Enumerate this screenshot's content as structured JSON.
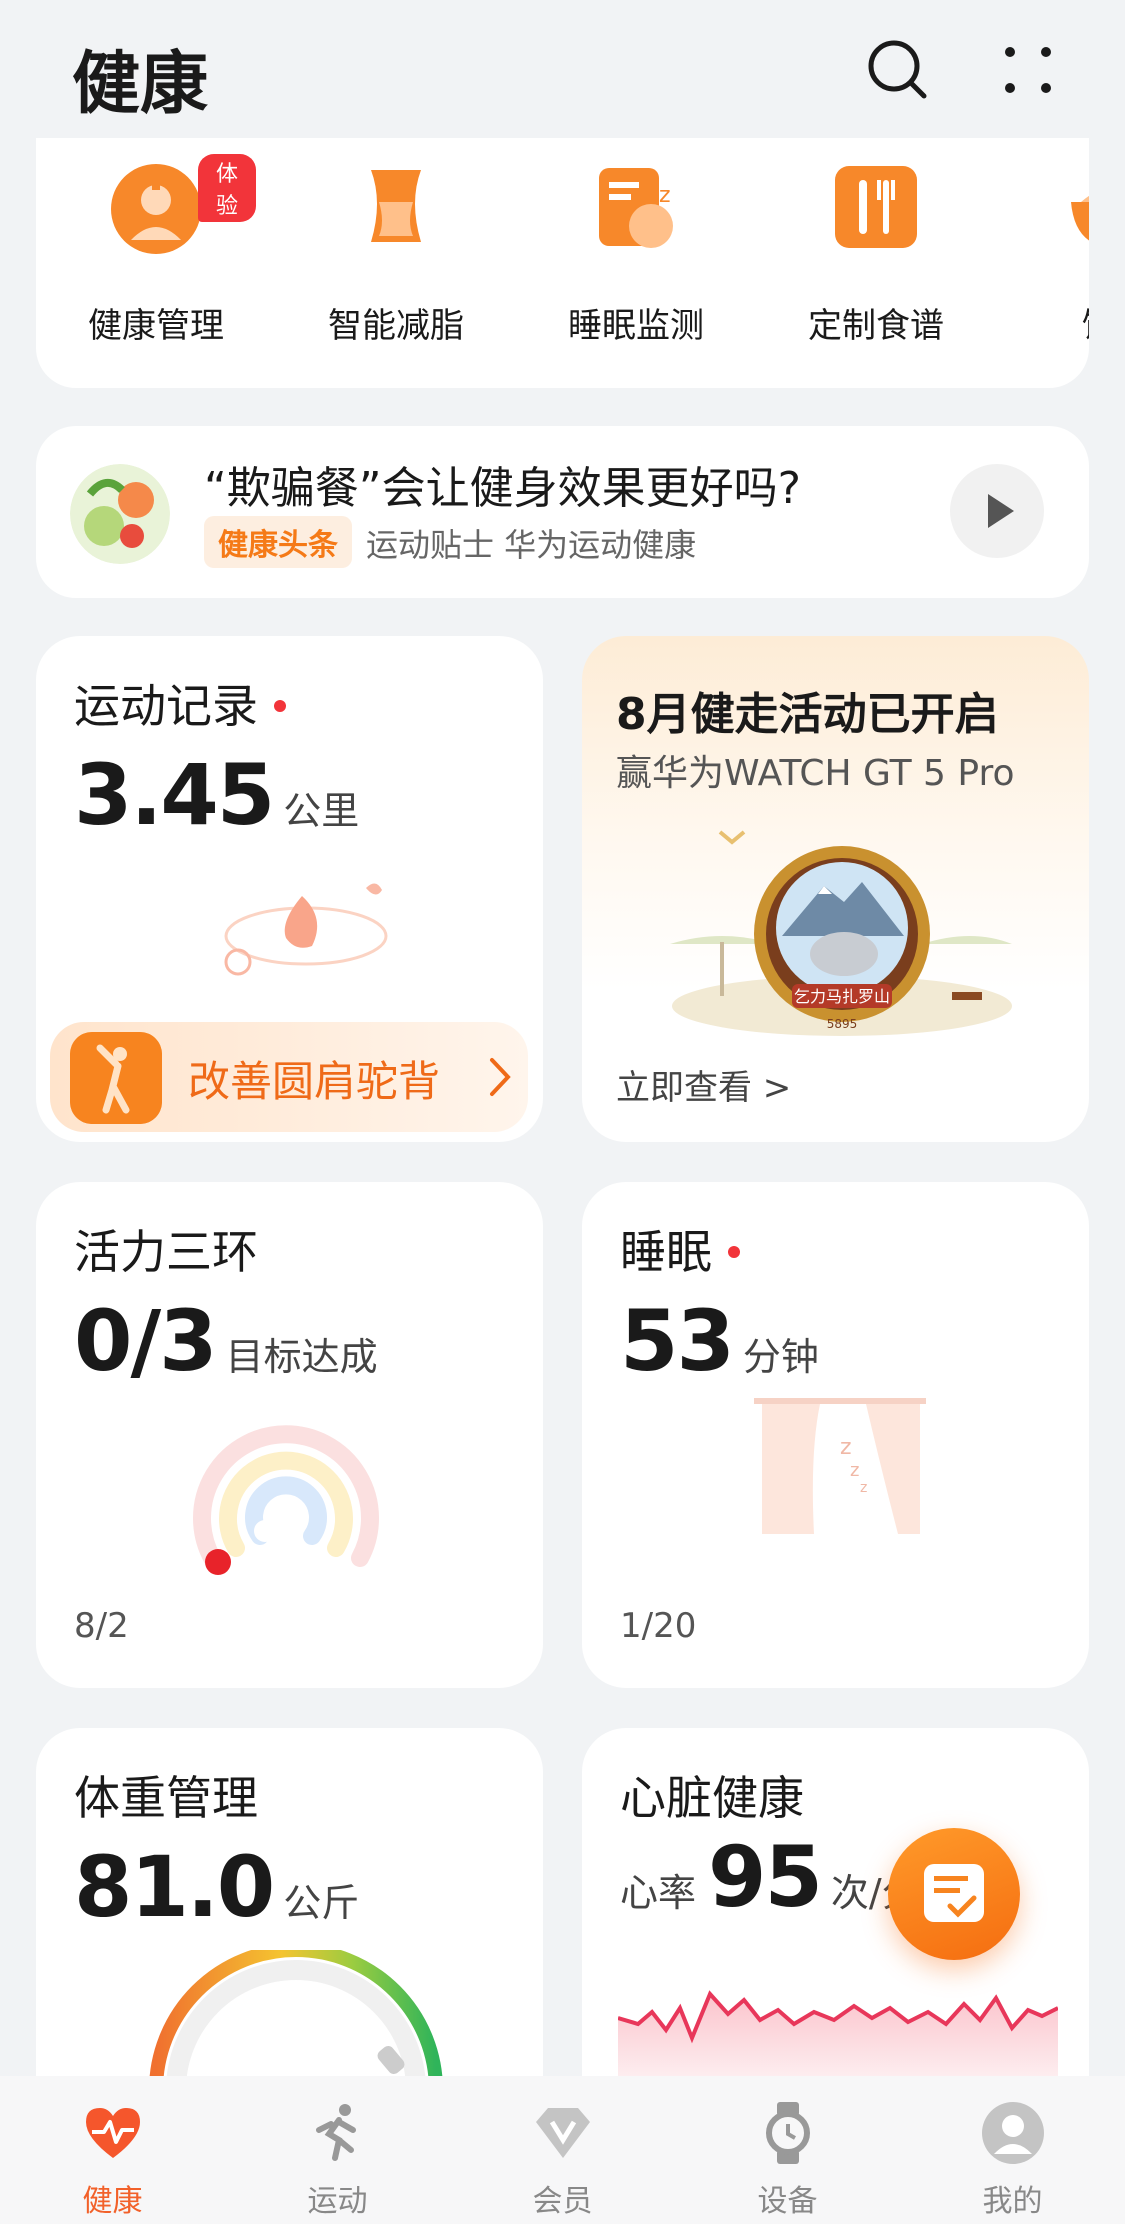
{
  "header": {
    "title": "健康",
    "search_icon": "search-icon",
    "more_icon": "more-icon"
  },
  "quick_entries": [
    {
      "label": "健康管理",
      "icon": "doctor-icon",
      "badge": "体验"
    },
    {
      "label": "智能减脂",
      "icon": "body-shape-icon"
    },
    {
      "label": "睡眠监测",
      "icon": "sleep-icon"
    },
    {
      "label": "定制食谱",
      "icon": "cutlery-icon"
    },
    {
      "label": "饮食",
      "icon": "food-icon"
    }
  ],
  "news": {
    "title": "“欺骗餐”会让健身效果更好吗?",
    "tag": "健康头条",
    "subtitle": "运动贴士 华为运动健康"
  },
  "sport": {
    "title": "运动记录",
    "value": "3.45",
    "unit": "公里",
    "promo": "改善圆肩驼背"
  },
  "event": {
    "title": "8月健走活动已开启",
    "subtitle": "赢华为WATCH GT 5 Pro",
    "link": "立即查看 >",
    "medal_text": "乞力马扎罗山",
    "medal_num": "5895"
  },
  "rings": {
    "title": "活力三环",
    "value": "0/3",
    "unit": "目标达成",
    "date": "8/2"
  },
  "sleep": {
    "title": "睡眠",
    "value": "53",
    "unit": "分钟",
    "date": "1/20"
  },
  "weight": {
    "title": "体重管理",
    "value": "81.0",
    "unit": "公斤"
  },
  "heart": {
    "title": "心脏健康",
    "label": "心率",
    "value": "95",
    "unit": "次/分"
  },
  "nav": [
    {
      "label": "健康",
      "icon": "heart-icon",
      "active": true
    },
    {
      "label": "运动",
      "icon": "running-icon"
    },
    {
      "label": "会员",
      "icon": "diamond-icon"
    },
    {
      "label": "设备",
      "icon": "watch-icon"
    },
    {
      "label": "我的",
      "icon": "profile-icon"
    }
  ],
  "colors": {
    "accent": "#f57a17",
    "active_nav": "#f2612a",
    "red_dot": "#f2343a"
  }
}
